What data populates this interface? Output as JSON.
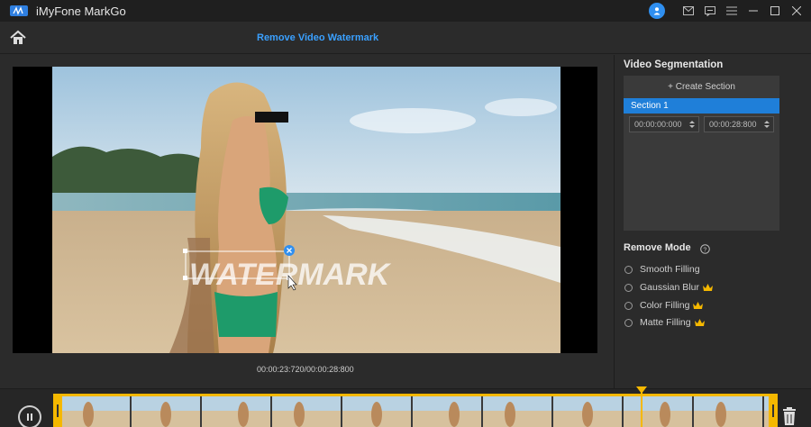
{
  "app": {
    "title": "iMyFone MarkGo",
    "logo_icon": "markgo-logo-icon",
    "accent_color": "#1f7fd9"
  },
  "titlebar": {
    "icons": [
      "user-avatar-icon",
      "mail-icon",
      "message-icon",
      "menu-icon",
      "minimize-icon",
      "maximize-icon",
      "close-icon"
    ]
  },
  "header": {
    "home_icon": "home-icon",
    "page_title": "Remove Video Watermark"
  },
  "preview": {
    "watermark_text": "WATERMARK",
    "time_readout": "00:00:23:720/00:00:28:800"
  },
  "segmentation": {
    "title": "Video Segmentation",
    "create_label": "+ Create Section",
    "section_label": "Section 1",
    "start_time": "00:00:00:000",
    "end_time": "00:00:28:800"
  },
  "remove_mode": {
    "title": "Remove Mode",
    "options": [
      {
        "label": "Smooth Filling",
        "premium": false
      },
      {
        "label": "Gaussian Blur",
        "premium": true
      },
      {
        "label": "Color Filling",
        "premium": true
      },
      {
        "label": "Matte Filling",
        "premium": true
      }
    ],
    "premium_color": "#f5b800"
  },
  "timeline": {
    "highlight_color": "#f5b800",
    "playhead_progress": 0.824
  }
}
